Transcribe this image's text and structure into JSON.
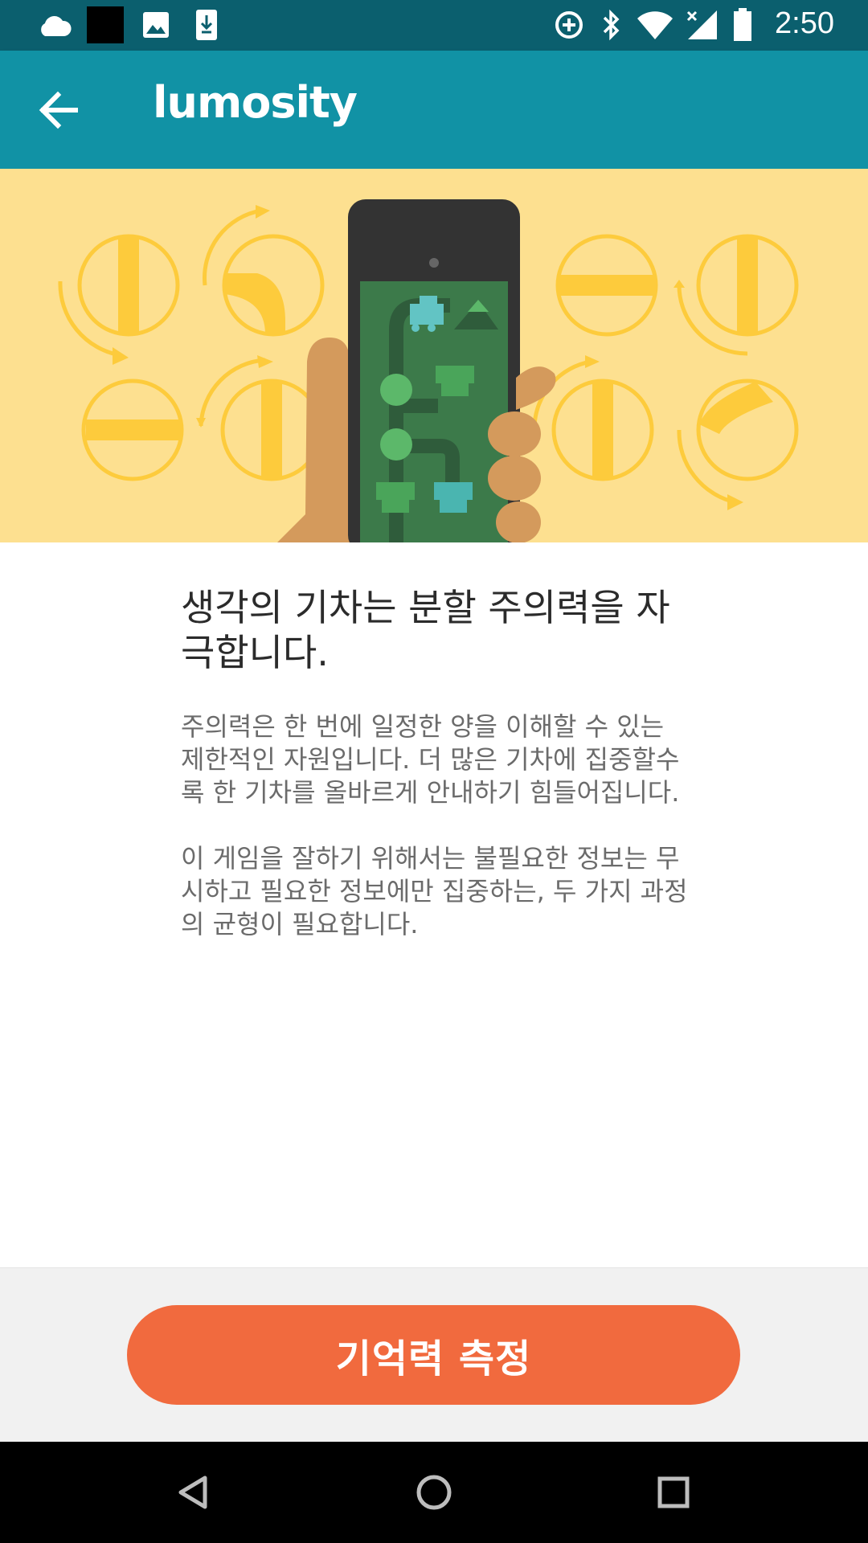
{
  "status_bar": {
    "time": "2:50",
    "icons": [
      "cloud-icon",
      "black-square-notification-icon",
      "image-icon",
      "download-icon",
      "data-saver-icon",
      "bluetooth-icon",
      "wifi-icon",
      "cellular-no-signal-icon",
      "battery-icon"
    ]
  },
  "app_bar": {
    "back_icon": "arrow-back-icon",
    "logo": "lumosity"
  },
  "hero": {
    "illustration": "hand-holding-phone-train-game-icon"
  },
  "content": {
    "headline": "생각의 기차는 분할 주의력을 자극합니다.",
    "paragraph1": "주의력은 한 번에 일정한 양을 이해할 수 있는 제한적인 자원입니다. 더 많은 기차에 집중할수록 한 기차를 올바르게 안내하기 힘들어집니다.",
    "paragraph2": "이 게임을 잘하기 위해서는 불필요한 정보는 무시하고 필요한 정보에만 집중하는, 두 가지 과정의 균형이 필요합니다."
  },
  "footer": {
    "button_label": "기억력 측정",
    "button_color": "#f16a3e"
  },
  "nav_bar": {
    "items": [
      "back-triangle-icon",
      "home-circle-icon",
      "recents-square-icon"
    ]
  },
  "colors": {
    "status_bar": "#0b5f6e",
    "app_bar": "#1192a5",
    "hero_background": "#fde090",
    "switch_yellow": "#fdcb3c"
  }
}
